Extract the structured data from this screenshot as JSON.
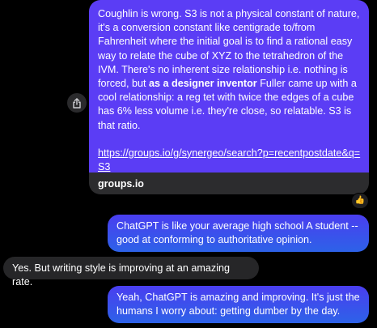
{
  "link_message": {
    "text_before_bold": "Coughlin is wrong. S3 is not a physical constant of nature, it's a conversion constant like centigrade to/from Fahrenheit where the initial goal is to find a rational easy way to relate the cube of XYZ to the tetrahedron of the IVM. There's no inherent size relationship i.e. nothing is forced, but ",
    "bold_text": "as a designer inventor",
    "text_after_bold": " Fuller came up with a cool relationship: a reg tet with twice the edges of a cube has 6% less volume i.e. they're close, so relatable.  S3 is that ratio.",
    "url": "https://groups.io/g/synergeo/search?p=recentpostdate&q=S3",
    "domain": "groups.io",
    "reaction": "👍"
  },
  "messages": [
    {
      "side": "out",
      "text": "ChatGPT is like your average high school A student -- good at conforming to authoritative opinion."
    },
    {
      "side": "in",
      "text": "Yes. But writing style is improving at an amazing rate."
    },
    {
      "side": "out",
      "text": "Yeah, ChatGPT is amazing and improving. It's just the humans I worry about: getting dumber by the day."
    }
  ],
  "colors": {
    "background": "#000000",
    "outgoing_bubble": "#3b4fd8",
    "link_body": "#5b3df5",
    "incoming_bubble": "#262628"
  }
}
